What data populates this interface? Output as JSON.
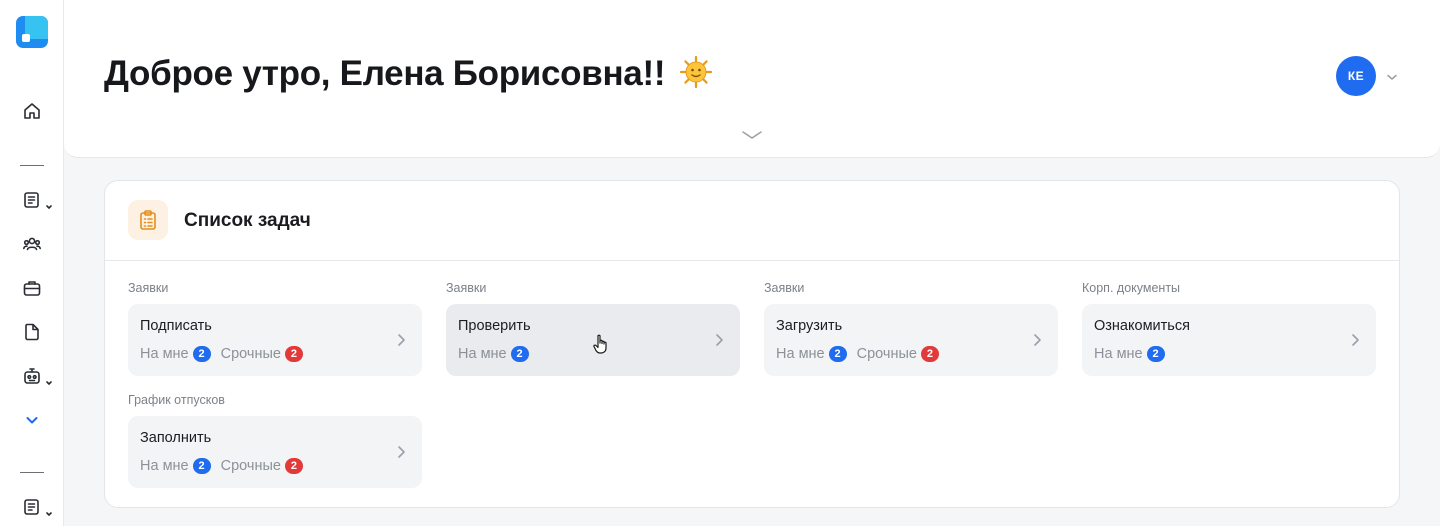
{
  "header": {
    "greeting": "Доброе утро, Елена Борисовна!!",
    "emoji": "🌞",
    "avatar_initials": "КЕ"
  },
  "sidebar": {
    "icons": [
      "home-icon",
      "document-list-icon",
      "users-icon",
      "briefcase-icon",
      "file-icon",
      "robot-icon",
      "chevron-down-icon",
      "document-list-icon"
    ]
  },
  "tasks_card": {
    "title": "Список задач",
    "icon": "clipboard-icon",
    "groups": [
      {
        "label": "Заявки",
        "title": "Подписать",
        "on_me_label": "На мне",
        "on_me_count": "2",
        "urgent_label": "Срочные",
        "urgent_count": "2"
      },
      {
        "label": "Заявки",
        "title": "Проверить",
        "on_me_label": "На мне",
        "on_me_count": "2"
      },
      {
        "label": "Заявки",
        "title": "Загрузить",
        "on_me_label": "На мне",
        "on_me_count": "2",
        "urgent_label": "Срочные",
        "urgent_count": "2"
      },
      {
        "label": "Корп. документы",
        "title": "Ознакомиться",
        "on_me_label": "На мне",
        "on_me_count": "2"
      },
      {
        "label": "График отпусков",
        "title": "Заполнить",
        "on_me_label": "На мне",
        "on_me_count": "2",
        "urgent_label": "Срочные",
        "urgent_count": "2"
      }
    ]
  },
  "colors": {
    "accent": "#1f6cf0",
    "urgent": "#e23a3a",
    "task_icon": "#e58e1c"
  }
}
